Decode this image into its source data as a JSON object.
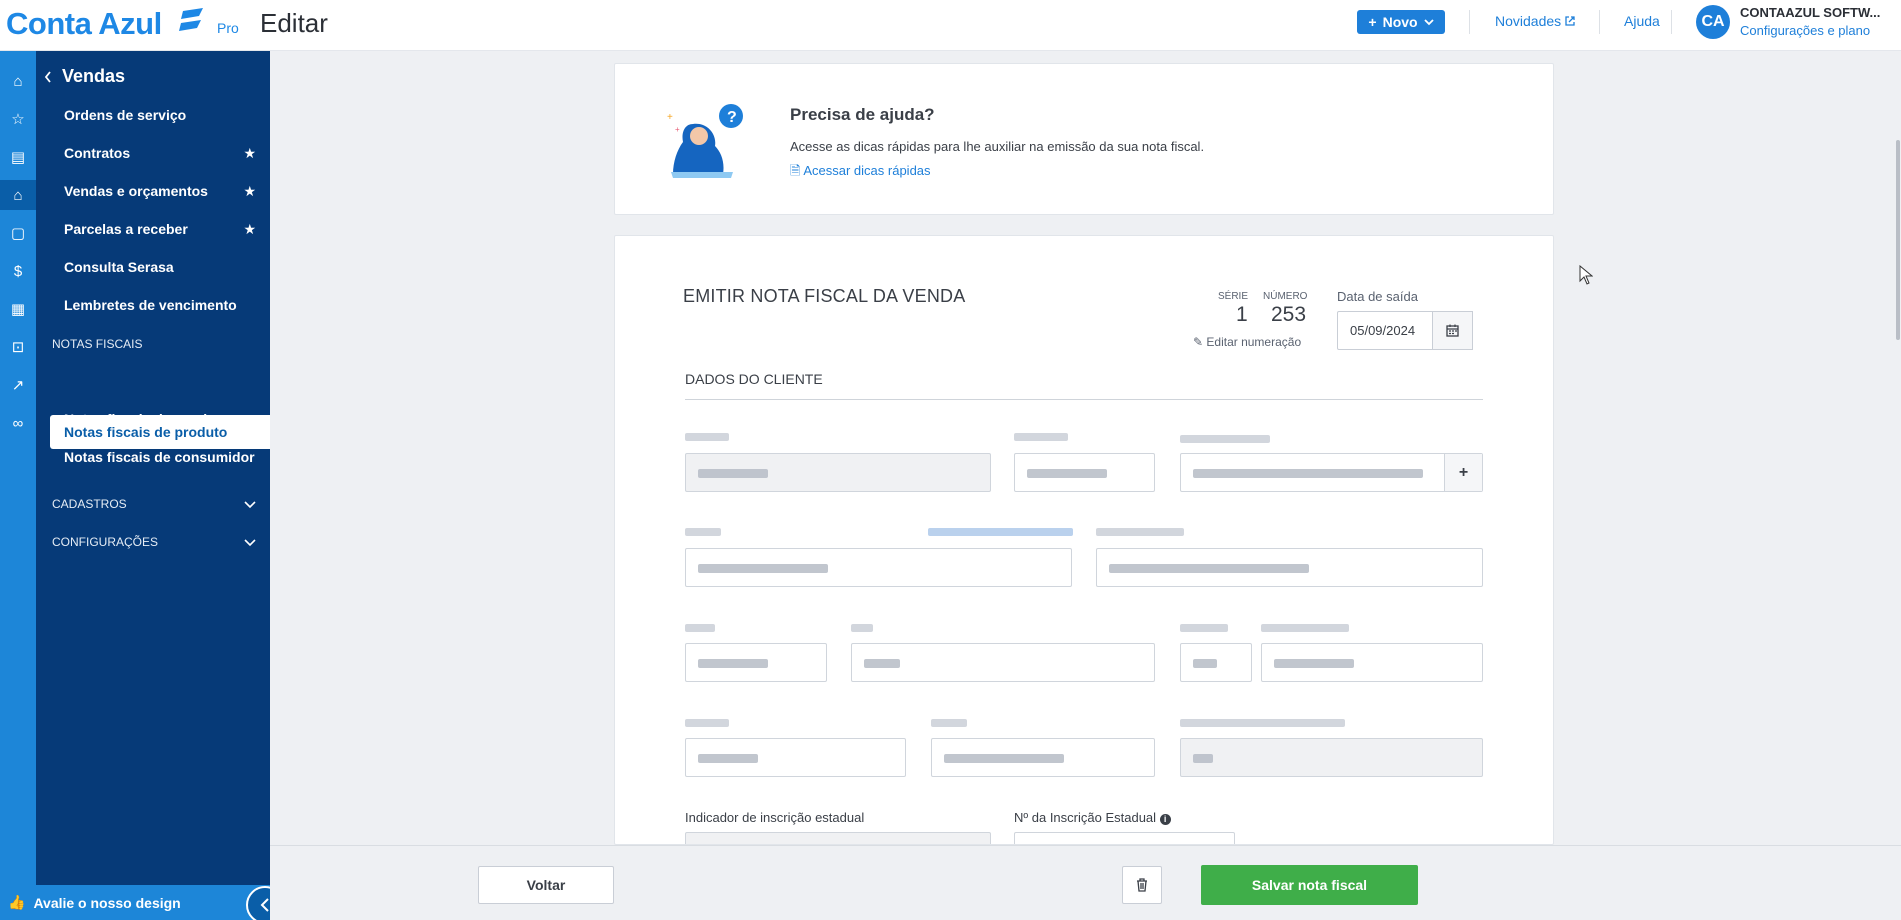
{
  "header": {
    "logo_text": "Conta Azul",
    "plan": "Pro",
    "page_title": "Editar",
    "new_button": "Novo",
    "news_link": "Novidades",
    "help_link": "Ajuda",
    "avatar_initials": "CA",
    "company_name": "CONTAAZUL SOFTW...",
    "company_sub": "Configurações e plano"
  },
  "sidebar": {
    "back_label": "Vendas",
    "items": [
      {
        "label": "Ordens de serviço",
        "starred": false
      },
      {
        "label": "Contratos",
        "starred": true
      },
      {
        "label": "Vendas e orçamentos",
        "starred": true
      },
      {
        "label": "Parcelas a receber",
        "starred": true
      },
      {
        "label": "Consulta Serasa",
        "starred": false
      },
      {
        "label": "Lembretes de vencimento",
        "starred": false
      }
    ],
    "section_notas": "NOTAS FISCAIS",
    "notas_items": [
      "Notas fiscais de produto",
      "Notas fiscais de serviço",
      "Notas fiscais de consumidor"
    ],
    "active_item": "Notas fiscais de produto",
    "section_cadastros": "CADASTROS",
    "section_config": "CONFIGURAÇÕES",
    "footer_label": "Avalie o nosso design"
  },
  "help_card": {
    "title": "Precisa de ajuda?",
    "text": "Acesse as dicas rápidas para lhe auxiliar na emissão da sua nota fiscal.",
    "link": "Acessar dicas rápidas"
  },
  "form": {
    "title": "EMITIR NOTA FISCAL DA VENDA",
    "serie_label": "SÉRIE",
    "serie_value": "1",
    "numero_label": "NÚMERO",
    "numero_value": "253",
    "edit_numbering": "Editar numeração",
    "date_label": "Data de saída",
    "date_value": "05/09/2024",
    "section_client": "DADOS DO CLIENTE",
    "label_indicador": "Indicador de inscrição estadual",
    "label_inscricao": "Nº da Inscrição Estadual"
  },
  "actions": {
    "back": "Voltar",
    "save": "Salvar nota fiscal"
  },
  "colors": {
    "brand": "#1e88e5",
    "sidebar": "#063a78",
    "save": "#3fae49"
  }
}
